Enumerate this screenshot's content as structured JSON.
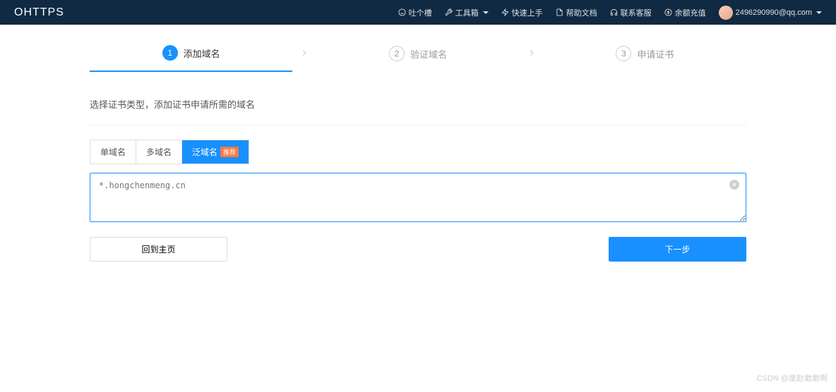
{
  "header": {
    "logo": "OHTTPS",
    "nav": {
      "feedback": "吐个槽",
      "toolbox": "工具箱",
      "quickstart": "快速上手",
      "help": "帮助文档",
      "contact": "联系客服",
      "balance": "余额充值",
      "user_email": "2496290990@qq.com"
    }
  },
  "steps": {
    "s1": {
      "num": "1",
      "label": "添加域名"
    },
    "s2": {
      "num": "2",
      "label": "验证域名"
    },
    "s3": {
      "num": "3",
      "label": "申请证书"
    }
  },
  "description": "选择证书类型，添加证书申请所需的域名",
  "tabs": {
    "single": "单域名",
    "multi": "多域名",
    "wildcard": "泛域名",
    "badge": "推荐"
  },
  "input": {
    "value": "*.hongchenmeng.cn"
  },
  "buttons": {
    "back": "回到主页",
    "next": "下一步"
  },
  "watermark": "CSDN @是赵敢敢啊"
}
